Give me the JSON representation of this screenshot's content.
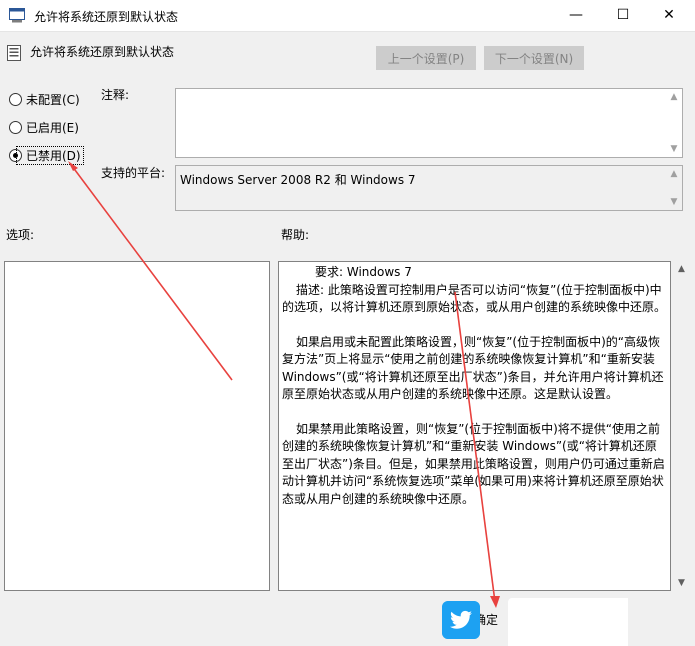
{
  "window": {
    "title": "允许将系统还原到默认状态",
    "minimize_glyph": "—",
    "maximize_glyph": "☐",
    "close_glyph": "✕"
  },
  "header": {
    "policy_name": "允许将系统还原到默认状态",
    "prev_button": "上一个设置(P)",
    "next_button": "下一个设置(N)"
  },
  "options": {
    "not_configured": "未配置(C)",
    "enabled": "已启用(E)",
    "disabled": "已禁用(D)",
    "selected": "disabled"
  },
  "comment": {
    "label": "注释:",
    "value": ""
  },
  "platform": {
    "label": "支持的平台:",
    "value": "Windows Server 2008 R2 和 Windows 7"
  },
  "sections": {
    "options_label": "选项:",
    "help_label": "帮助:"
  },
  "help": {
    "requirement": "要求: Windows 7",
    "paragraph1": "描述: 此策略设置可控制用户是否可以访问“恢复”(位于控制面板中)中的选项，以将计算机还原到原始状态，或从用户创建的系统映像中还原。",
    "paragraph2": "如果启用或未配置此策略设置，则“恢复”(位于控制面板中)的“高级恢复方法”页上将显示“使用之前创建的系统映像恢复计算机”和“重新安装 Windows”(或“将计算机还原至出厂状态”)条目，并允许用户将计算机还原至原始状态或从用户创建的系统映像中还原。这是默认设置。",
    "paragraph3": "如果禁用此策略设置，则“恢复”(位于控制面板中)将不提供“使用之前创建的系统映像恢复计算机”和“重新安装 Windows”(或“将计算机还原至出厂状态”)条目。但是，如果禁用此策略设置，则用户仍可通过重新启动计算机并访问“系统恢复选项”菜单(如果可用)来将计算机还原至原始状态或从用户创建的系统映像中还原。"
  },
  "footer": {
    "ok_button": "确定"
  },
  "annotation": {
    "color": "#e8423f"
  }
}
